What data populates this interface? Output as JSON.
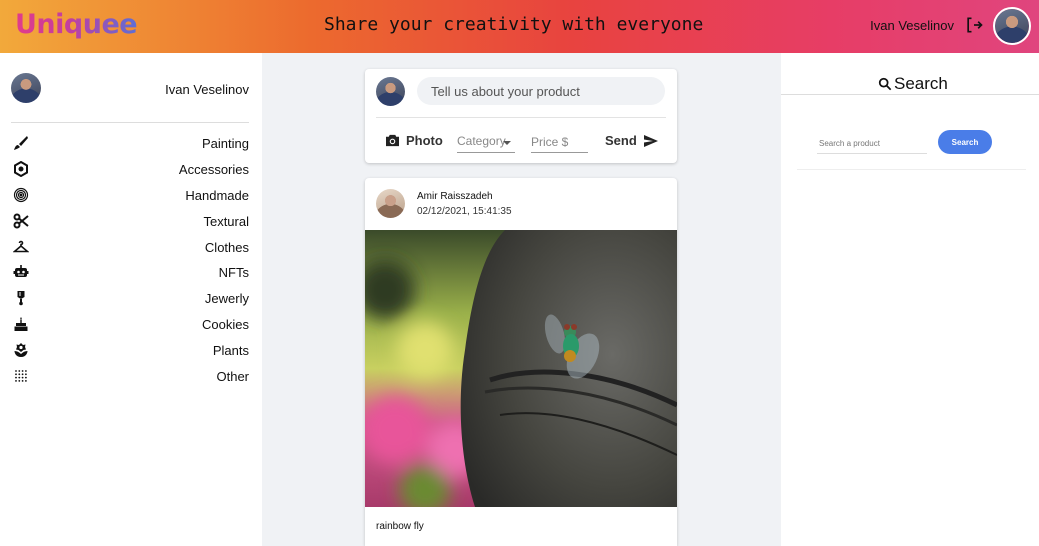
{
  "header": {
    "logo": "Uniquee",
    "tagline": "Share your creativity with everyone",
    "user_name": "Ivan Veselinov"
  },
  "sidebar": {
    "user_name": "Ivan Veselinov",
    "categories": [
      {
        "label": "Painting",
        "icon": "brush-icon"
      },
      {
        "label": "Accessories",
        "icon": "accessories-icon"
      },
      {
        "label": "Handmade",
        "icon": "fingerprint-icon"
      },
      {
        "label": "Textural",
        "icon": "scissors-icon"
      },
      {
        "label": "Clothes",
        "icon": "hanger-icon"
      },
      {
        "label": "NFTs",
        "icon": "robot-icon"
      },
      {
        "label": "Jewerly",
        "icon": "medal-icon"
      },
      {
        "label": "Cookies",
        "icon": "cake-icon"
      },
      {
        "label": "Plants",
        "icon": "flower-icon"
      },
      {
        "label": "Other",
        "icon": "dots-grid-icon"
      }
    ]
  },
  "composer": {
    "placeholder": "Tell us about your product",
    "photo_label": "Photo",
    "category_label": "Category",
    "price_placeholder": "Price $",
    "send_label": "Send"
  },
  "post": {
    "author": "Amir Raisszadeh",
    "date": "02/12/2021, 15:41:35",
    "caption": "rainbow fly"
  },
  "search": {
    "title": "Search",
    "placeholder": "Search a product",
    "button_label": "Search"
  },
  "colors": {
    "accent": "#4a7de8",
    "header_gradient_start": "#f2a93b",
    "header_gradient_mid": "#e8433f",
    "header_gradient_end": "#e0457e"
  }
}
